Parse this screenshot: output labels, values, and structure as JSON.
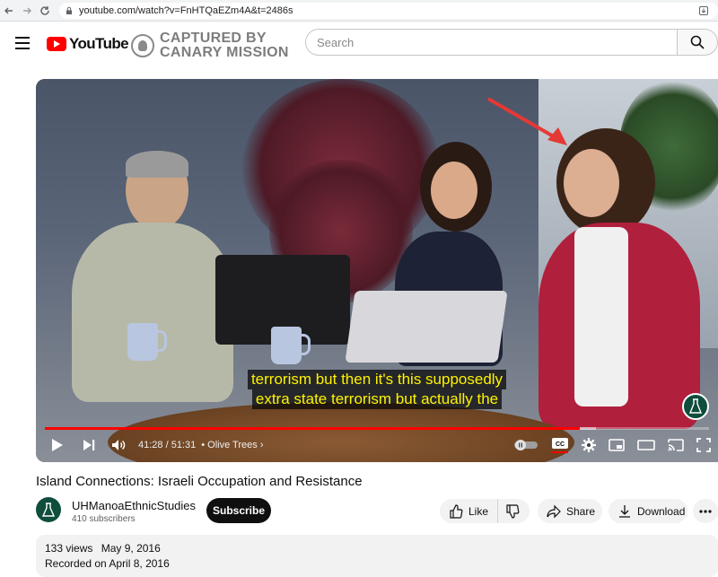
{
  "browser": {
    "url": "youtube.com/watch?v=FnHTQaEZm4A&t=2486s"
  },
  "masthead": {
    "logo_text": "YouTube",
    "overlay_line1": "CAPTURED BY",
    "overlay_line2": "CANARY MISSION",
    "search_placeholder": "Search"
  },
  "player": {
    "caption_line1": "terrorism but then it's this supposedly",
    "caption_line2": "extra state terrorism but actually the",
    "time_text": "41:28 / 51:31",
    "chapter_text": "• Olive Trees",
    "progress_played": 0.805,
    "progress_buffered": 0.83,
    "cc_enabled": true
  },
  "video": {
    "title": "Island Connections: Israeli Occupation and Resistance",
    "channel_name": "UHManoaEthnicStudies",
    "subscribers": "410 subscribers",
    "subscribe_label": "Subscribe",
    "like_label": "Like",
    "share_label": "Share",
    "download_label": "Download",
    "views": "133 views",
    "date": "May 9, 2016",
    "description": "Recorded on April 8, 2016"
  },
  "colors": {
    "accent": "#ff0000",
    "caption_text": "#fff200",
    "subscribe_bg": "#0f0f0f"
  }
}
